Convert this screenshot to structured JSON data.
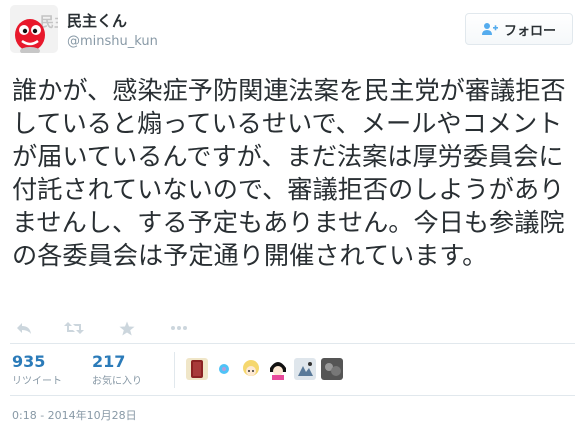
{
  "user": {
    "display_name": "民主くん",
    "screen_name": "@minshu_kun",
    "avatar_text": "民主"
  },
  "follow_button": {
    "label": "フォロー",
    "icon": "add-person-icon"
  },
  "tweet": {
    "text": "誰かが、感染症予防関連法案を民主党が審議拒否していると煽っているせいで、メールやコメントが届いているんですが、まだ法案は厚労委員会に付託されていないので、審議拒否のしようがありませんし、する予定もありません。今日も参議院の各委員会は予定通り開催されています。"
  },
  "actions": [
    {
      "name": "reply",
      "icon": "reply-icon"
    },
    {
      "name": "retweet",
      "icon": "retweet-icon"
    },
    {
      "name": "favorite",
      "icon": "star-icon"
    },
    {
      "name": "more",
      "icon": "more-icon"
    }
  ],
  "stats": {
    "retweets": {
      "count": "935",
      "label": "リツイート"
    },
    "favorites": {
      "count": "217",
      "label": "お気に入り"
    }
  },
  "favoriters": [
    {
      "icon": "user-avatar-icon",
      "color": "#8b2323"
    },
    {
      "icon": "user-avatar-icon",
      "color": "#4fc3f7"
    },
    {
      "icon": "user-avatar-icon",
      "color": "#f5d76e"
    },
    {
      "icon": "user-avatar-icon",
      "color": "#e84a9b"
    },
    {
      "icon": "user-avatar-icon",
      "color": "#5a7a9a"
    },
    {
      "icon": "user-avatar-icon",
      "color": "#555555"
    }
  ],
  "timestamp": "0:18 - 2014年10月28日",
  "colors": {
    "link_blue": "#2b7bb9",
    "text": "#292f33",
    "muted": "#8899a6",
    "border": "#e1e8ed",
    "mascot_red": "#e8192c"
  }
}
